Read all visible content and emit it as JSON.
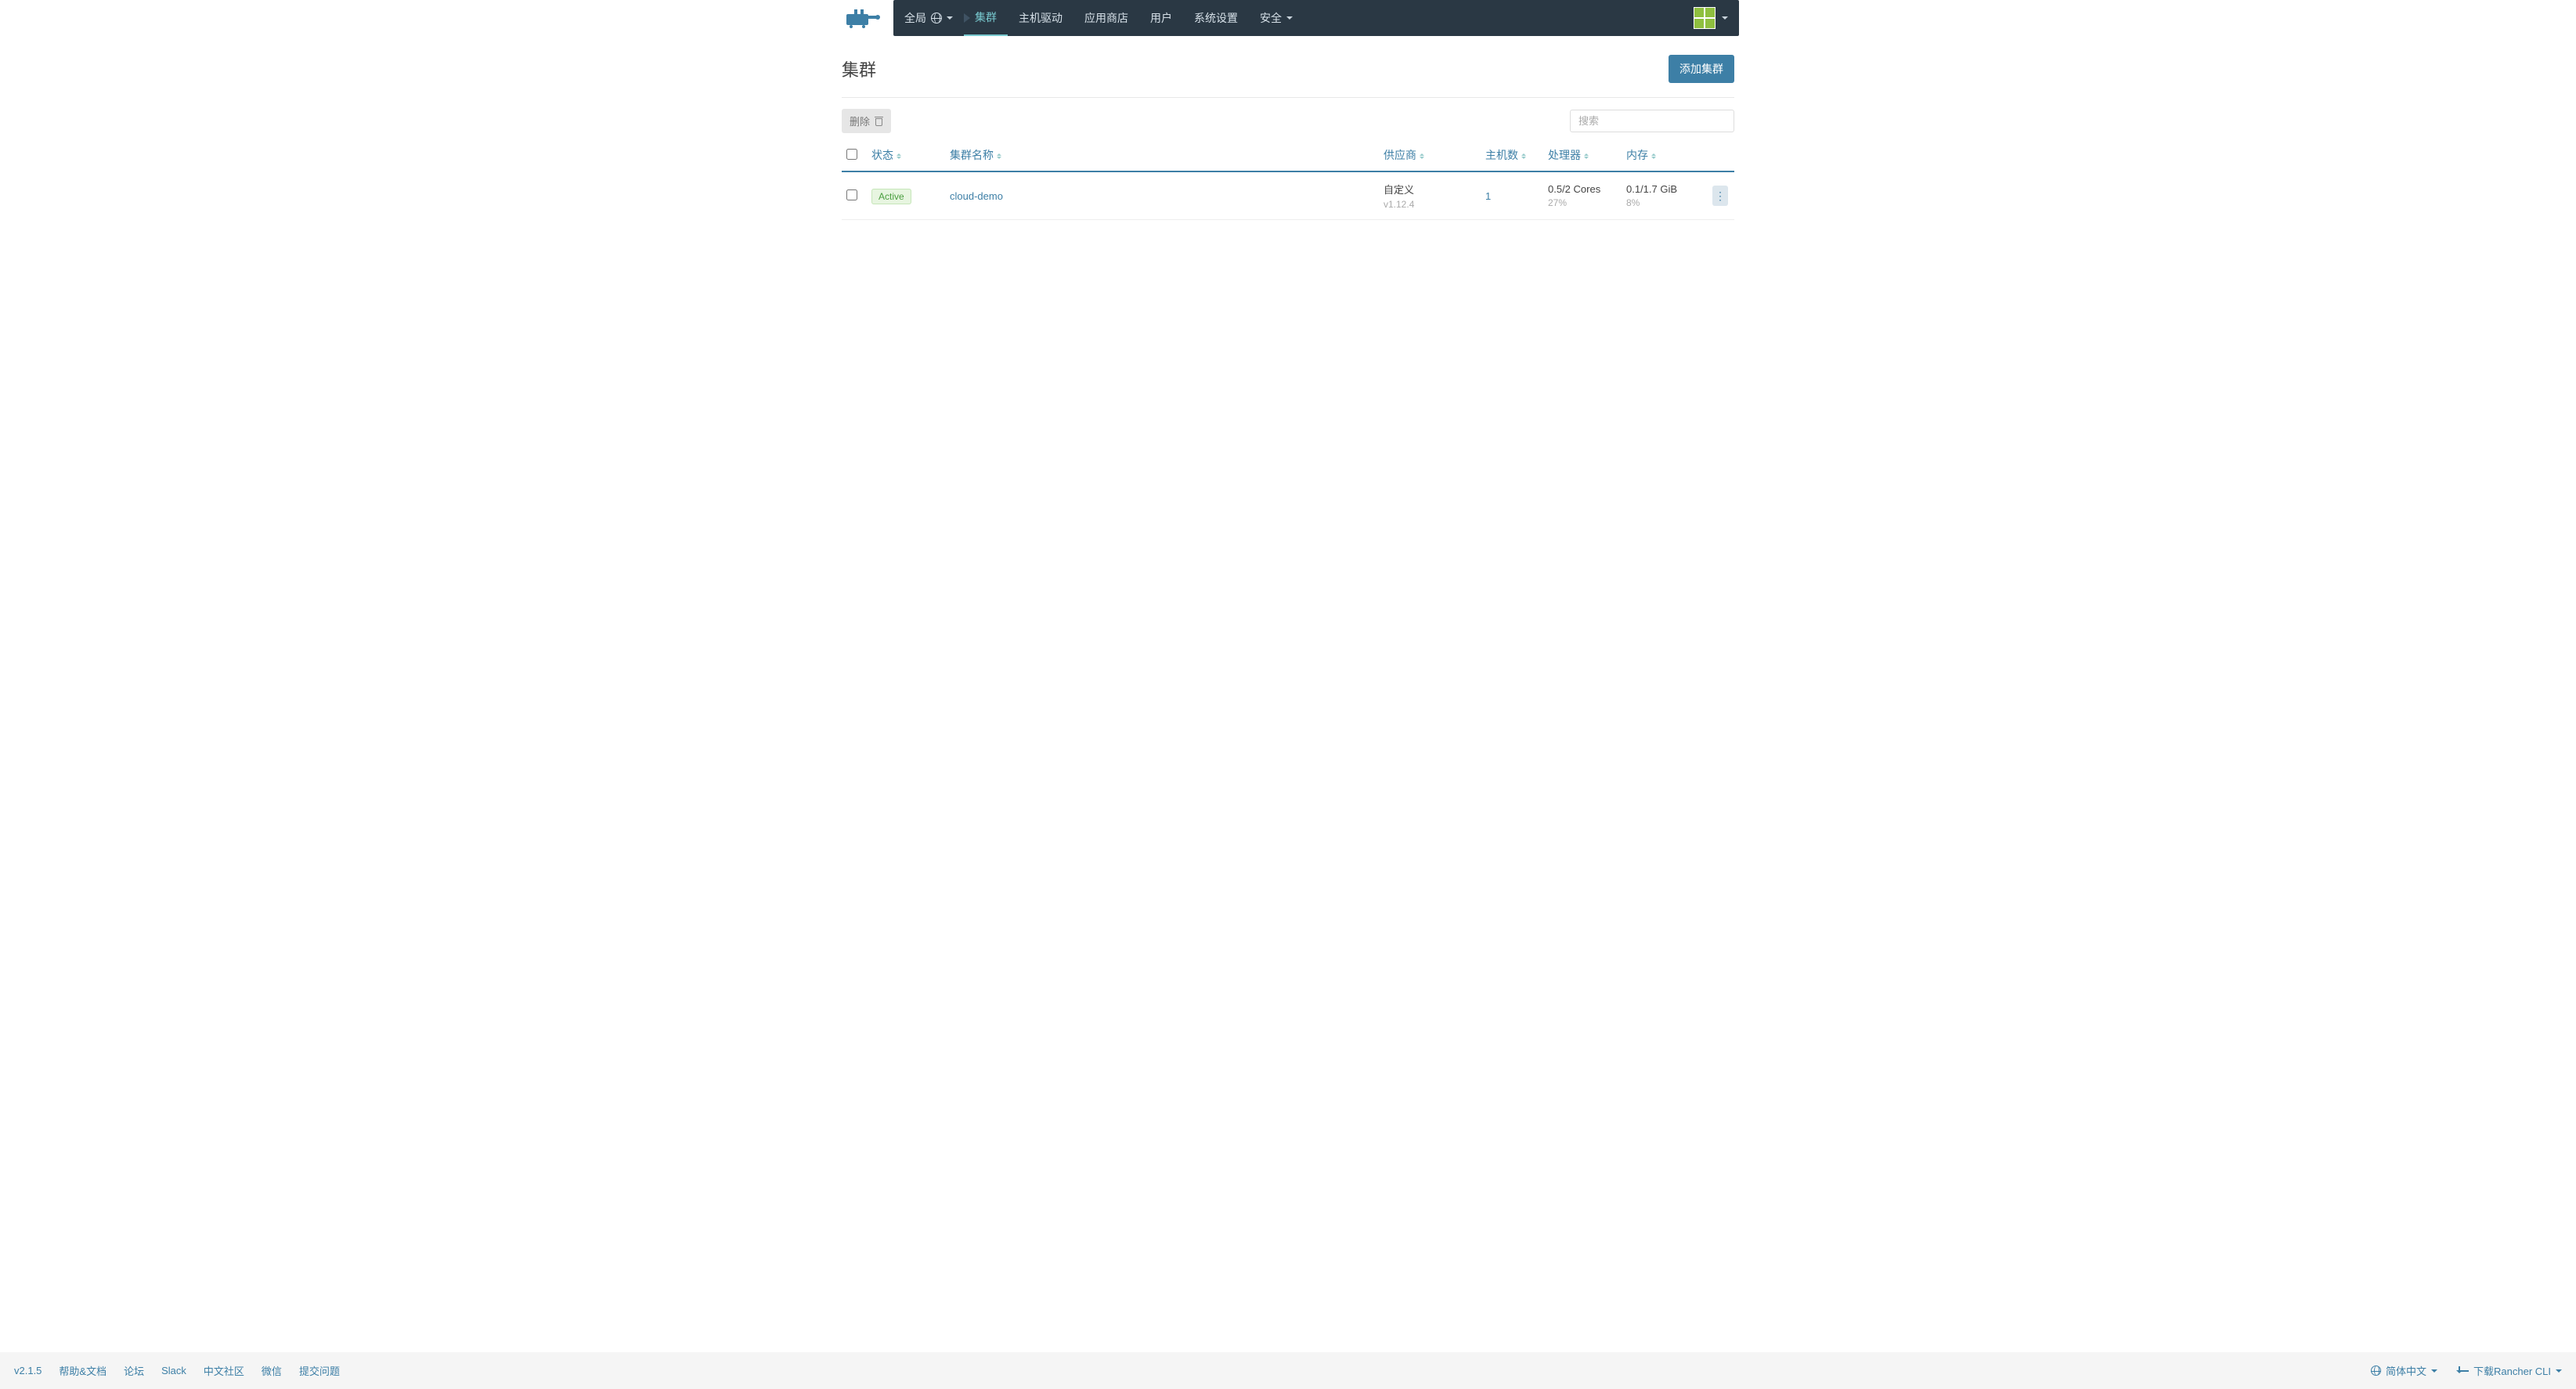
{
  "nav": {
    "scope_label": "全局",
    "items": [
      "集群",
      "主机驱动",
      "应用商店",
      "用户",
      "系统设置",
      "安全"
    ],
    "active_index": 0,
    "security_has_dropdown": true
  },
  "page": {
    "title": "集群",
    "add_button": "添加集群",
    "delete_button": "删除",
    "search_placeholder": "搜索"
  },
  "table": {
    "headers": {
      "state": "状态",
      "name": "集群名称",
      "provider": "供应商",
      "nodes": "主机数",
      "cpu": "处理器",
      "ram": "内存"
    },
    "rows": [
      {
        "state": "Active",
        "name": "cloud-demo",
        "provider": "自定义",
        "provider_sub": "v1.12.4",
        "nodes": "1",
        "cpu": "0.5/2 Cores",
        "cpu_sub": "27%",
        "ram": "0.1/1.7 GiB",
        "ram_sub": "8%"
      }
    ]
  },
  "footer": {
    "version": "v2.1.5",
    "links": [
      "帮助&文档",
      "论坛",
      "Slack",
      "中文社区",
      "微信",
      "提交问题"
    ],
    "lang": "简体中文",
    "download": "下载Rancher CLI"
  }
}
